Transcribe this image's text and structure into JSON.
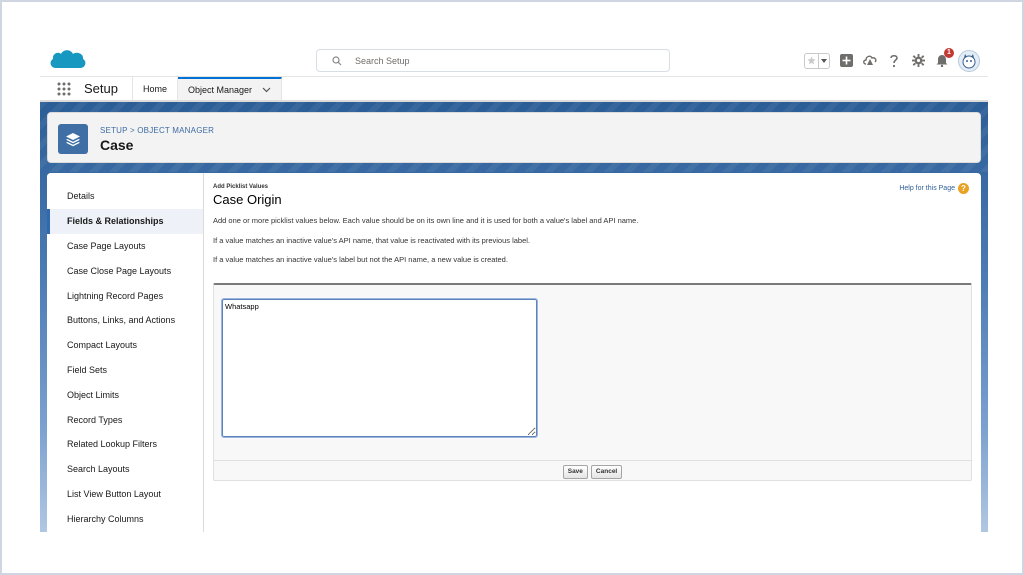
{
  "header": {
    "search_placeholder": "Search Setup",
    "notification_count": "1"
  },
  "nav": {
    "app_name": "Setup",
    "tabs": [
      {
        "label": "Home"
      },
      {
        "label": "Object Manager"
      }
    ]
  },
  "page_header": {
    "breadcrumb": "SETUP > OBJECT MANAGER",
    "title": "Case"
  },
  "sidebar": {
    "items": [
      {
        "label": "Details"
      },
      {
        "label": "Fields & Relationships"
      },
      {
        "label": "Case Page Layouts"
      },
      {
        "label": "Case Close Page Layouts"
      },
      {
        "label": "Lightning Record Pages"
      },
      {
        "label": "Buttons, Links, and Actions"
      },
      {
        "label": "Compact Layouts"
      },
      {
        "label": "Field Sets"
      },
      {
        "label": "Object Limits"
      },
      {
        "label": "Record Types"
      },
      {
        "label": "Related Lookup Filters"
      },
      {
        "label": "Search Layouts"
      },
      {
        "label": "List View Button Layout"
      },
      {
        "label": "Hierarchy Columns"
      }
    ]
  },
  "content": {
    "subtitle": "Add Picklist Values",
    "title": "Case Origin",
    "help_link": "Help for this Page",
    "help_icon_glyph": "?",
    "descriptions": [
      "Add one or more picklist values below. Each value should be on its own line and it is used for both a value's label and API name.",
      "If a value matches an inactive value's API name, that value is reactivated with its previous label.",
      "If a value matches an inactive value's label but not the API name, a new value is created."
    ],
    "textarea_value": "Whatsapp",
    "save_label": "Save",
    "cancel_label": "Cancel"
  }
}
